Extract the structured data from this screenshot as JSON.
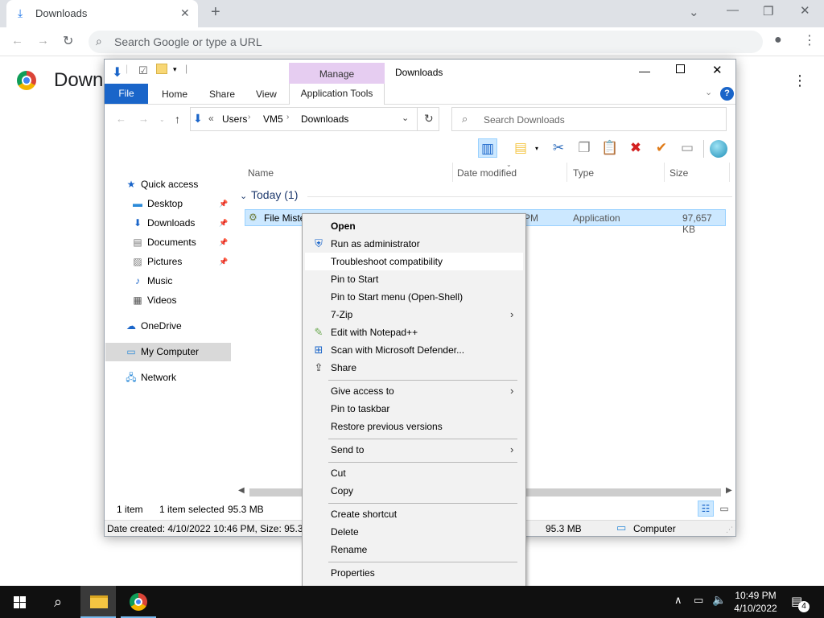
{
  "browser": {
    "tab_title": "Downloads",
    "omnibox_placeholder": "Search Google or type a URL",
    "page_title": "Downl"
  },
  "explorer": {
    "title": "Downloads",
    "manage_label": "Manage",
    "ribbon_tabs": {
      "file": "File",
      "home": "Home",
      "share": "Share",
      "view": "View",
      "app_tools": "Application Tools"
    },
    "address": {
      "prefix": "«",
      "crumbs": [
        "Users",
        "VM5",
        "Downloads"
      ]
    },
    "search_placeholder": "Search Downloads",
    "columns": {
      "name": "Name",
      "date": "Date modified",
      "type": "Type",
      "size": "Size"
    },
    "group_label": "Today (1)",
    "file": {
      "name": "File Miste",
      "date_fragment": "PM",
      "type": "Application",
      "size": "97,657 KB"
    },
    "nav": {
      "quick_access": "Quick access",
      "desktop": "Desktop",
      "downloads": "Downloads",
      "documents": "Documents",
      "pictures": "Pictures",
      "music": "Music",
      "videos": "Videos",
      "onedrive": "OneDrive",
      "my_computer": "My Computer",
      "network": "Network"
    },
    "status": {
      "items": "1 item",
      "selected": "1 item selected",
      "selected_size": "95.3 MB"
    },
    "details": {
      "left": "Date created: 4/10/2022 10:46 PM, Size: 95.3 M",
      "size": "95.3 MB",
      "location": "Computer"
    }
  },
  "context_menu": {
    "open": "Open",
    "run_admin": "Run as administrator",
    "troubleshoot": "Troubleshoot compatibility",
    "pin_start": "Pin to Start",
    "pin_start_menu": "Pin to Start menu (Open-Shell)",
    "zip": "7-Zip",
    "notepad": "Edit with Notepad++",
    "defender": "Scan with Microsoft Defender...",
    "share": "Share",
    "give_access": "Give access to",
    "pin_taskbar": "Pin to taskbar",
    "restore": "Restore previous versions",
    "send_to": "Send to",
    "cut": "Cut",
    "copy": "Copy",
    "create_shortcut": "Create shortcut",
    "delete": "Delete",
    "rename": "Rename",
    "properties": "Properties"
  },
  "taskbar": {
    "time": "10:49 PM",
    "date": "4/10/2022",
    "notification_count": "4"
  },
  "colors": {
    "accent": "#1a65c9",
    "selection": "#cce8ff",
    "manage": "#e6cdf1",
    "taskbar": "#101010"
  }
}
